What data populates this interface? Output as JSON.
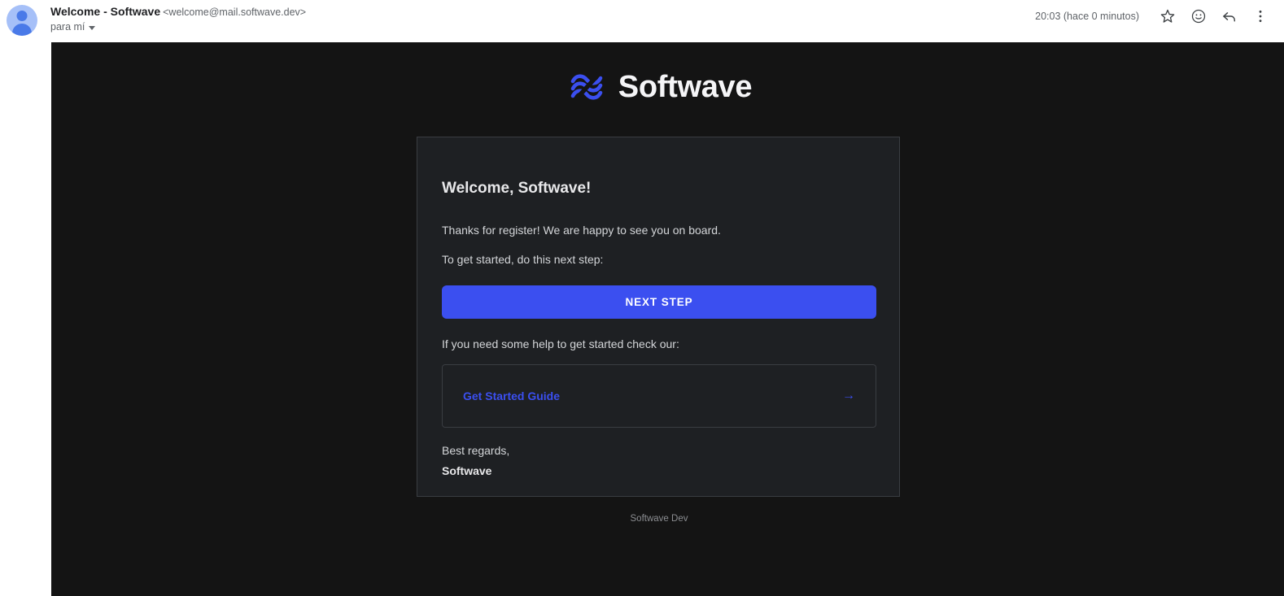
{
  "mail_header": {
    "sender_name": "Welcome - Softwave",
    "sender_email": "<welcome@mail.softwave.dev>",
    "recipient": "para mí",
    "timestamp": "20:03 (hace 0 minutos)",
    "icons": {
      "star": "star-icon",
      "emoji": "emoji-icon",
      "reply": "reply-icon",
      "more": "more-options-icon"
    }
  },
  "email": {
    "brand": {
      "name": "Softwave",
      "logo_color": "#3b4ff0",
      "text_color": "#f5f5f7"
    },
    "card": {
      "title": "Welcome, Softwave!",
      "paragraph_1": "Thanks for register! We are happy to see you on board.",
      "paragraph_2": "To get started, do this next step:",
      "cta_label": "NEXT STEP",
      "cta_color": "#3b4ff0",
      "help_text": "If you need some help to get started check our:",
      "guide_label": "Get Started Guide",
      "guide_arrow": "→",
      "signoff": "Best regards,",
      "signoff_name": "Softwave"
    },
    "footer": "Softwave Dev",
    "background": "#141414",
    "card_background": "#1e2023"
  }
}
